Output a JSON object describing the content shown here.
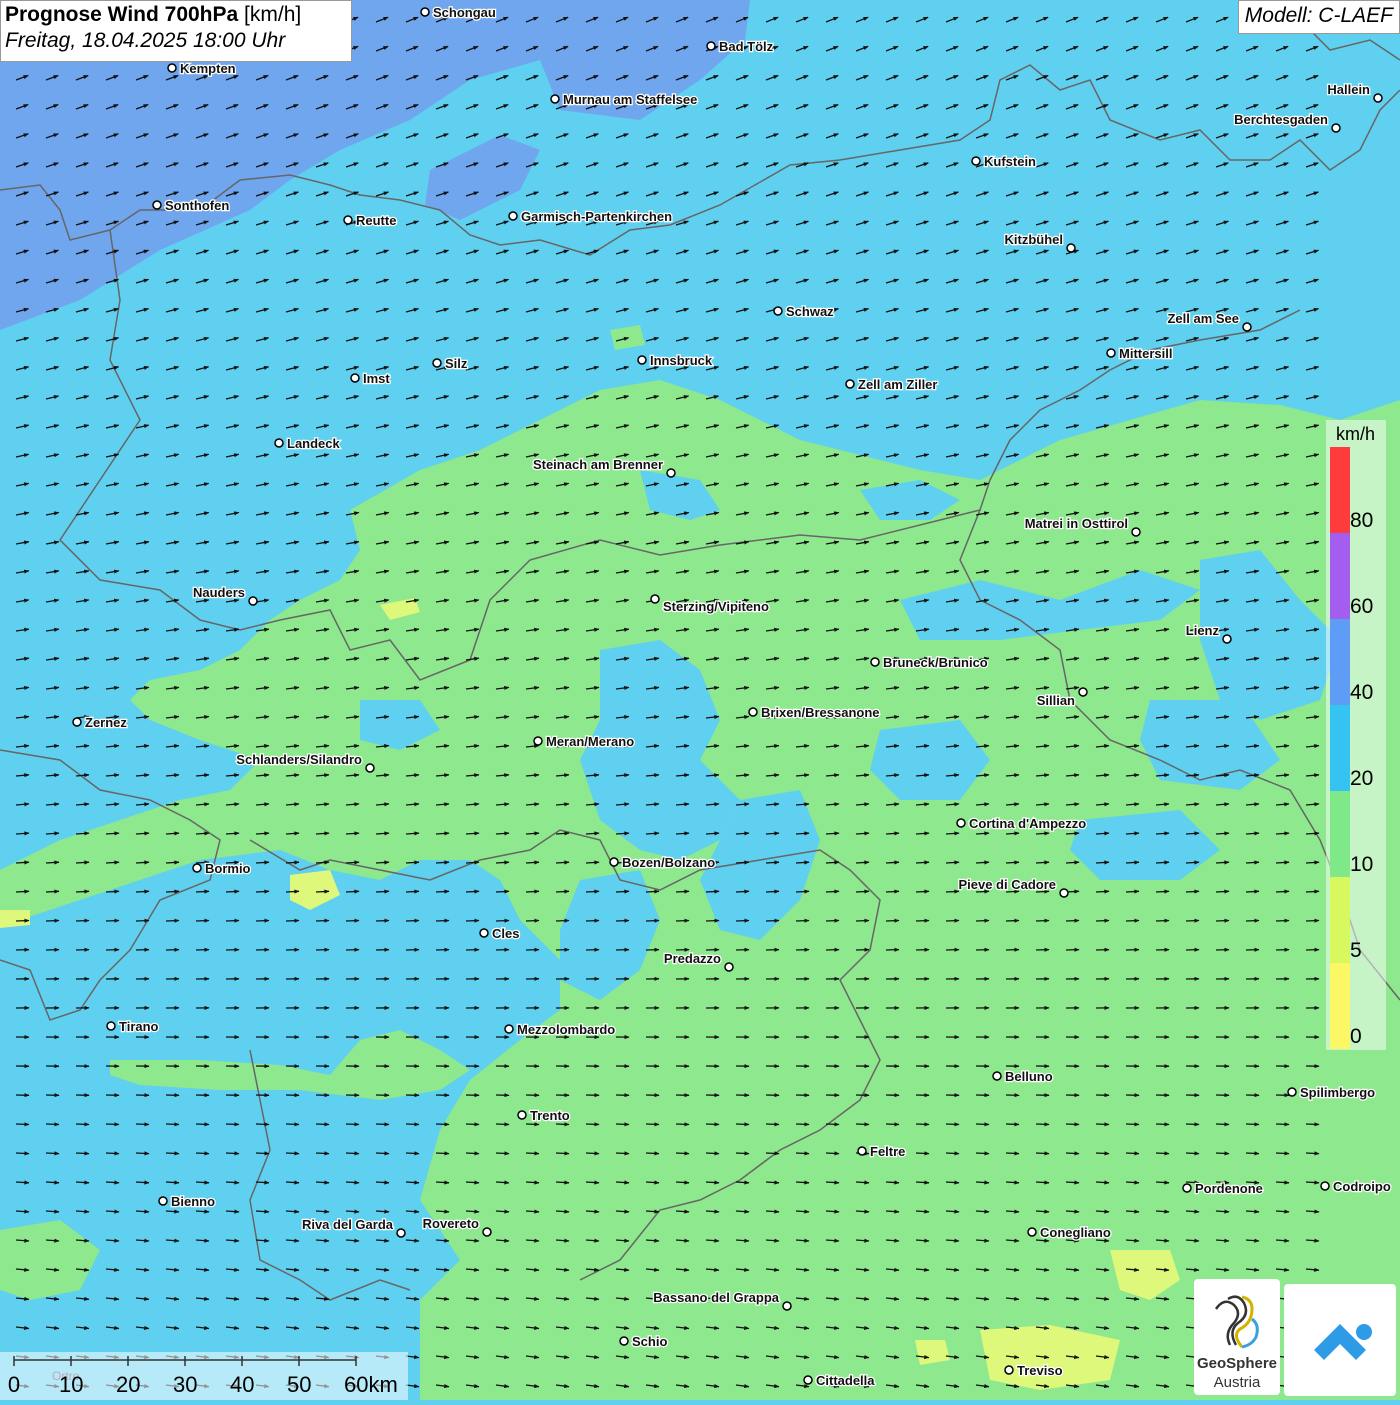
{
  "header": {
    "title_bold": "Prognose Wind 700hPa",
    "title_unit": "[km/h]",
    "subtitle": "Freitag, 18.04.2025 18:00 Uhr",
    "model": "Modell: C-LAEF"
  },
  "legend": {
    "unit": "km/h",
    "ticks": [
      "80",
      "60",
      "40",
      "20",
      "10",
      "5",
      "0"
    ],
    "colors": [
      "#ff3b3b",
      "#a35ef0",
      "#5f9cf6",
      "#35c4f2",
      "#7fe98a",
      "#d8f860",
      "#fbf765"
    ]
  },
  "scale": {
    "labels": [
      "0",
      "10",
      "20",
      "30",
      "40",
      "50",
      "60km"
    ],
    "watermark": "Ortro"
  },
  "logos": {
    "geosphere_line1": "GeoSphere",
    "geosphere_line2": "Austria"
  },
  "cities": [
    {
      "name": "Schongau"
    },
    {
      "name": "Bad Tölz"
    },
    {
      "name": "Kempten"
    },
    {
      "name": "Murnau am Staffelsee"
    },
    {
      "name": "Hallein"
    },
    {
      "name": "Berchtesgaden"
    },
    {
      "name": "Kufstein"
    },
    {
      "name": "Sonthofen"
    },
    {
      "name": "Reutte"
    },
    {
      "name": "Garmisch-Partenkirchen"
    },
    {
      "name": "Kitzbühel"
    },
    {
      "name": "Schwaz"
    },
    {
      "name": "Zell am See"
    },
    {
      "name": "Mittersill"
    },
    {
      "name": "Innsbruck"
    },
    {
      "name": "Silz"
    },
    {
      "name": "Imst"
    },
    {
      "name": "Zell am Ziller"
    },
    {
      "name": "Landeck"
    },
    {
      "name": "Steinach am Brenner"
    },
    {
      "name": "Matrei in Osttirol"
    },
    {
      "name": "Nauders"
    },
    {
      "name": "Sterzing/Vipiteno"
    },
    {
      "name": "Lienz"
    },
    {
      "name": "Bruneck/Brunico"
    },
    {
      "name": "Sillian"
    },
    {
      "name": "Brixen/Bressanone"
    },
    {
      "name": "Zernez"
    },
    {
      "name": "Meran/Merano"
    },
    {
      "name": "Schlanders/Silandro"
    },
    {
      "name": "Cortina d'Ampezzo"
    },
    {
      "name": "Bozen/Bolzano"
    },
    {
      "name": "Bormio"
    },
    {
      "name": "Pieve di Cadore"
    },
    {
      "name": "Cles"
    },
    {
      "name": "Predazzo"
    },
    {
      "name": "Tirano"
    },
    {
      "name": "Mezzolombardo"
    },
    {
      "name": "Belluno"
    },
    {
      "name": "Spilimbergo"
    },
    {
      "name": "Trento"
    },
    {
      "name": "Feltre"
    },
    {
      "name": "Bienno"
    },
    {
      "name": "Pordenone"
    },
    {
      "name": "Codroipo"
    },
    {
      "name": "Riva del Garda"
    },
    {
      "name": "Rovereto"
    },
    {
      "name": "Conegliano"
    },
    {
      "name": "Bassano del Grappa"
    },
    {
      "name": "Schio"
    },
    {
      "name": "Treviso"
    },
    {
      "name": "Cittadella"
    }
  ]
}
